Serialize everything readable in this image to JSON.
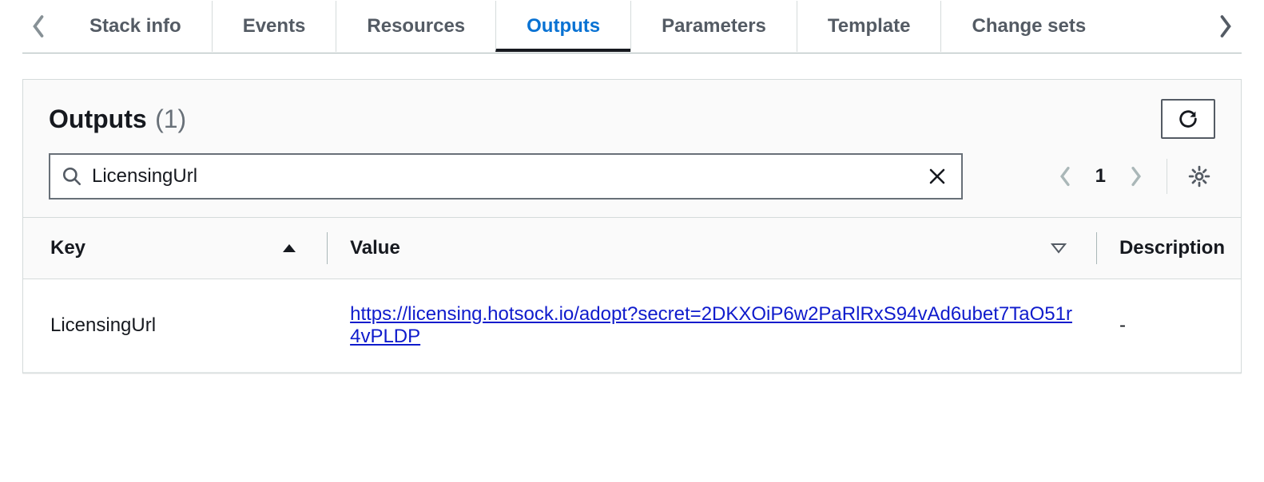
{
  "tabs": {
    "items": [
      {
        "label": "Stack info"
      },
      {
        "label": "Events"
      },
      {
        "label": "Resources"
      },
      {
        "label": "Outputs"
      },
      {
        "label": "Parameters"
      },
      {
        "label": "Template"
      },
      {
        "label": "Change sets"
      }
    ],
    "active_index": 3
  },
  "panel": {
    "title": "Outputs",
    "count": "(1)"
  },
  "search": {
    "value": "LicensingUrl"
  },
  "pagination": {
    "current": "1"
  },
  "columns": {
    "key": "Key",
    "value": "Value",
    "description": "Description"
  },
  "rows": [
    {
      "key": "LicensingUrl",
      "value": "https://licensing.hotsock.io/adopt?secret=2DKXOiP6w2PaRlRxS94vAd6ubet7TaO51r4vPLDP",
      "description": "-"
    }
  ]
}
